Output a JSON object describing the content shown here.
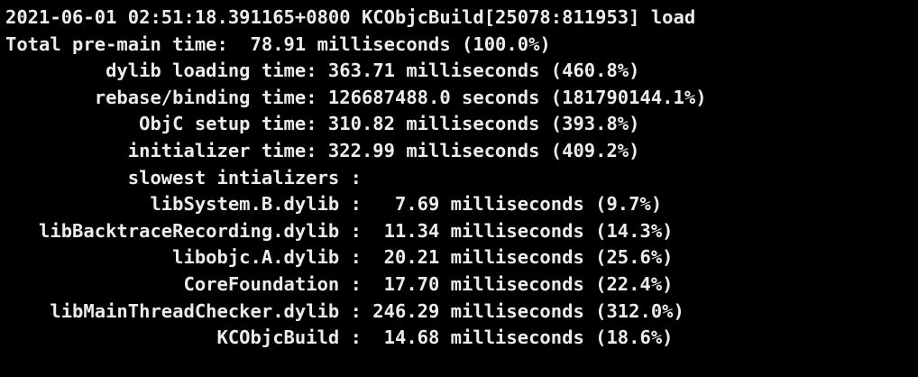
{
  "terminal": {
    "lines": [
      "2021-06-01 02:51:18.391165+0800 KCObjcBuild[25078:811953] load",
      "Total pre-main time:  78.91 milliseconds (100.0%)",
      "         dylib loading time: 363.71 milliseconds (460.8%)",
      "        rebase/binding time: 126687488.0 seconds (181790144.1%)",
      "            ObjC setup time: 310.82 milliseconds (393.8%)",
      "           initializer time: 322.99 milliseconds (409.2%)",
      "           slowest intializers :",
      "             libSystem.B.dylib :   7.69 milliseconds (9.7%)",
      "   libBacktraceRecording.dylib :  11.34 milliseconds (14.3%)",
      "               libobjc.A.dylib :  20.21 milliseconds (25.6%)",
      "                CoreFoundation :  17.70 milliseconds (22.4%)",
      "    libMainThreadChecker.dylib : 246.29 milliseconds (312.0%)",
      "                   KCObjcBuild :  14.68 milliseconds (18.6%)"
    ]
  },
  "colors": {
    "background": "#000000",
    "text": "#ececec"
  }
}
